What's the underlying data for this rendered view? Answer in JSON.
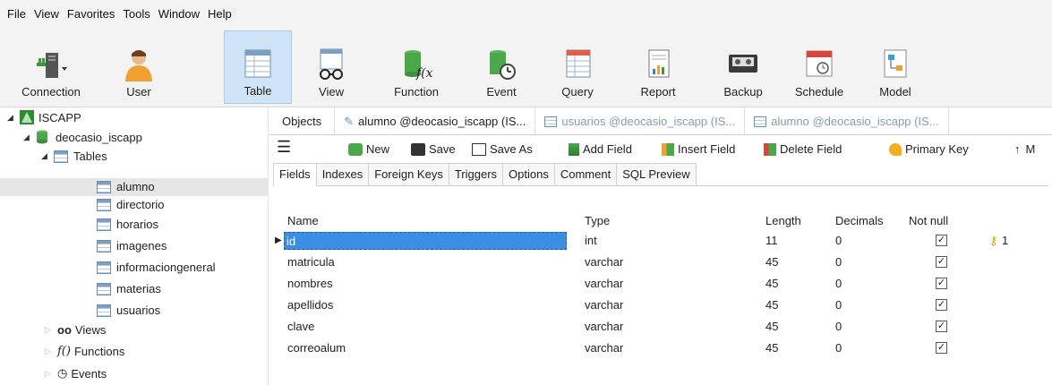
{
  "menu": [
    "File",
    "View",
    "Favorites",
    "Tools",
    "Window",
    "Help"
  ],
  "ribbon": {
    "connection": "Connection",
    "user": "User",
    "table": "Table",
    "view": "View",
    "function": "Function",
    "event": "Event",
    "query": "Query",
    "report": "Report",
    "backup": "Backup",
    "schedule": "Schedule",
    "model": "Model"
  },
  "tree": {
    "connection": "ISCAPP",
    "database": "deocasio_iscapp",
    "tables_label": "Tables",
    "tables": [
      "alumno",
      "directorio",
      "horarios",
      "imagenes",
      "informaciongeneral",
      "materias",
      "usuarios"
    ],
    "views": "Views",
    "functions": "Functions",
    "events": "Events"
  },
  "tabs": {
    "objects": "Objects",
    "tab1": "alumno @deocasio_iscapp (IS...",
    "tab2": "usuarios @deocasio_iscapp (IS...",
    "tab3": "alumno @deocasio_iscapp (IS..."
  },
  "toolbar": {
    "new": "New",
    "save": "Save",
    "save_as": "Save As",
    "add_field": "Add Field",
    "insert_field": "Insert Field",
    "delete_field": "Delete Field",
    "primary_key": "Primary Key",
    "move": "M"
  },
  "subtabs": [
    "Fields",
    "Indexes",
    "Foreign Keys",
    "Triggers",
    "Options",
    "Comment",
    "SQL Preview"
  ],
  "columns": {
    "name": "Name",
    "type": "Type",
    "length": "Length",
    "decimals": "Decimals",
    "not_null": "Not null"
  },
  "rows": [
    {
      "name": "id",
      "type": "int",
      "length": "11",
      "decimals": "0",
      "key": "1"
    },
    {
      "name": "matricula",
      "type": "varchar",
      "length": "45",
      "decimals": "0"
    },
    {
      "name": "nombres",
      "type": "varchar",
      "length": "45",
      "decimals": "0"
    },
    {
      "name": "apellidos",
      "type": "varchar",
      "length": "45",
      "decimals": "0"
    },
    {
      "name": "clave",
      "type": "varchar",
      "length": "45",
      "decimals": "0"
    },
    {
      "name": "correoalum",
      "type": "varchar",
      "length": "45",
      "decimals": "0"
    }
  ],
  "check_glyph": "✓"
}
